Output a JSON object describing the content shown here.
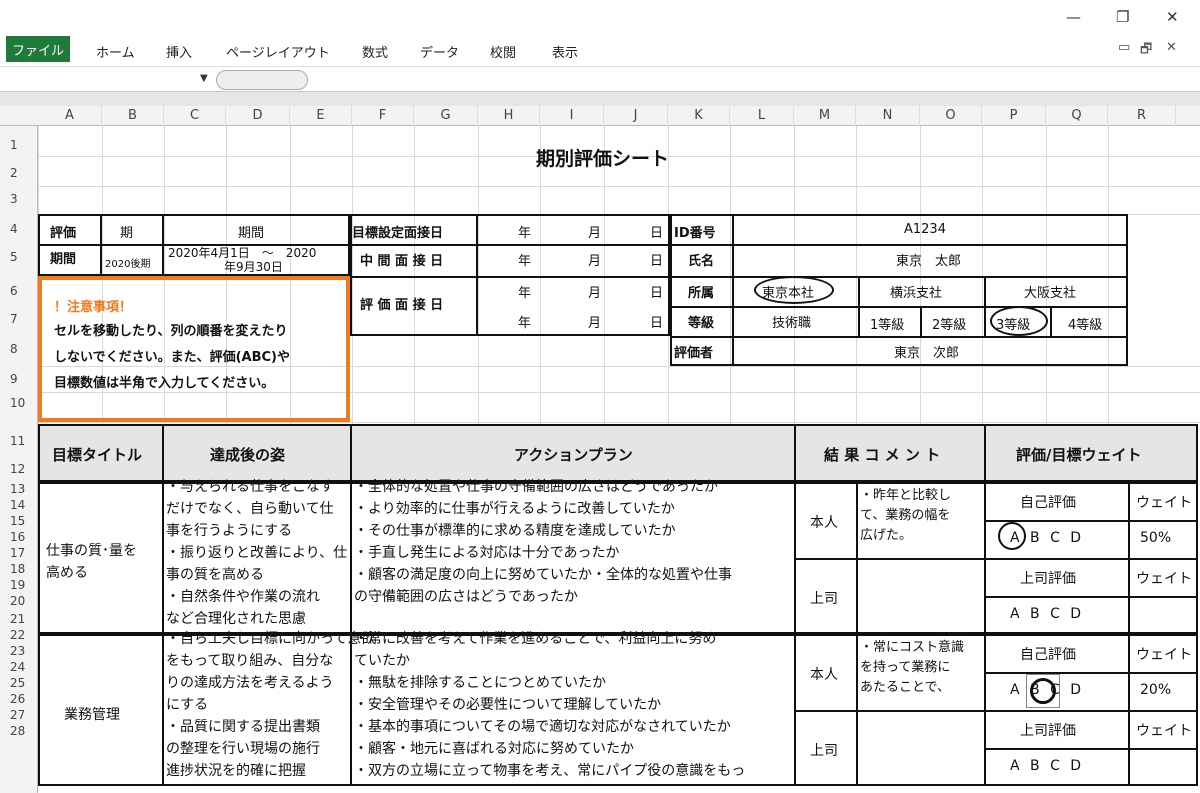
{
  "window": {
    "minimize": "—",
    "restore": "❐",
    "close": "✕"
  },
  "ribbon": {
    "file": "ファイル",
    "tabs": [
      "ホーム",
      "挿入",
      "ページレイアウト",
      "数式",
      "データ",
      "校閲",
      "表示"
    ],
    "controls": [
      "▭",
      "🗗",
      "✕"
    ]
  },
  "formula_bar": {
    "dropdown": "▼",
    "value": ""
  },
  "columns": [
    "A",
    "B",
    "C",
    "D",
    "E",
    "F",
    "G",
    "H",
    "I",
    "J",
    "K",
    "L",
    "M",
    "N",
    "O",
    "P",
    "Q",
    "R"
  ],
  "rows": [
    "1",
    "2",
    "3",
    "4",
    "5",
    "6",
    "7",
    "8",
    "9",
    "10",
    "11",
    "12",
    "13",
    "14",
    "15",
    "16",
    "17",
    "18",
    "19",
    "20",
    "21",
    "22",
    "23",
    "24",
    "25",
    "26",
    "27",
    "28"
  ],
  "sheet": {
    "title": "期別評価シート",
    "period": {
      "label_a": "評価",
      "label_b": "期間",
      "term_h": "期",
      "term_v": "2020後期",
      "period_h": "期間",
      "period_v1": "2020年4月1日　～　2020",
      "period_v2": "年9月30日"
    },
    "dates": {
      "goal": "目標設定面接日",
      "mid": "中 間 面 接 日",
      "eval": "評 価 面 接 日",
      "year": "年",
      "month": "月",
      "day": "日"
    },
    "info": {
      "id_label": "ID番号",
      "id_value": "A1234",
      "name_label": "氏名",
      "name_value": "東京　太郎",
      "dept_label": "所属",
      "depts": [
        "東京本社",
        "横浜支社",
        "大阪支社"
      ],
      "grade_label": "等級",
      "grades": [
        "技術職",
        "1等級",
        "2等級",
        "3等級",
        "4等級"
      ],
      "evaluator_label": "評価者",
      "evaluator_value": "東京　次郎"
    },
    "notice": {
      "title": "！注意事項！",
      "lines": [
        "セルを移動したり、列の順番を変えたり",
        "しないでください。また、評価(ABC)や",
        "目標数値は半角で入力してください。"
      ]
    },
    "headers": {
      "goal_title": "目標タイトル",
      "achievement": "達成後の姿",
      "action_plan": "アクションプラン",
      "result_comment": "結 果 コ メ ン ト",
      "eval_weight": "評価/目標ウェイト"
    },
    "goals": [
      {
        "title_lines": [
          "仕事の質･量を",
          "高める"
        ],
        "achievement": [
          "・与えられる仕事をこなす",
          "だけでなく、自ら動いて仕",
          "事を行うようにする",
          "・振り返りと改善により、仕",
          "事の質を高める",
          "・自然条件や作業の流れ",
          "など合理化された思慮"
        ],
        "actions": [
          "・全体的な処置や仕事の守備範囲の広さはどうであったか",
          "・より効率的に仕事が行えるように改善していたか",
          "・その仕事が標準的に求める精度を達成していたか",
          "・手直し発生による対応は十分であったか",
          "・顧客の満足度の向上に努めていたか・全体的な処置や仕事",
          "の守備範囲の広さはどうであったか"
        ],
        "self": "本人",
        "boss": "上司",
        "comment": [
          "・昨年と比較し",
          "て、業務の幅を",
          "広げた。"
        ],
        "self_eval": "自己評価",
        "weight": "ウェイト",
        "abcd": "A B C D",
        "weight_value": "50%",
        "boss_eval": "上司評価",
        "boss_weight": "ウェイト",
        "boss_abcd": "A B C D"
      },
      {
        "title_lines": [
          "業務管理"
        ],
        "achievement": [
          "・自ら工夫し目標に向かって意欲",
          "をもって取り組み、自分な",
          "りの達成方法を考えるよう",
          "にする",
          "・品質に関する提出書類",
          "の整理を行い現場の施行",
          "進捗状況を的確に把握"
        ],
        "actions": [
          "・常に改善を考えて作業を進めることで、利益向上に努め",
          "ていたか",
          "・無駄を排除することにつとめていたか",
          "・安全管理やその必要性について理解していたか",
          "・基本的事項についてその場で適切な対応がなされていたか",
          "・顧客・地元に喜ばれる対応に努めていたか",
          "・双方の立場に立って物事を考え、常にパイプ役の意識をもっ"
        ],
        "self": "本人",
        "boss": "上司",
        "comment": [
          "・常にコスト意識",
          "を持って業務に",
          "あたることで、"
        ],
        "self_eval": "自己評価",
        "weight": "ウェイト",
        "abcd": "A B C D",
        "weight_value": "20%",
        "boss_eval": "上司評価",
        "boss_weight": "ウェイト",
        "boss_abcd": "A B C D"
      }
    ]
  }
}
